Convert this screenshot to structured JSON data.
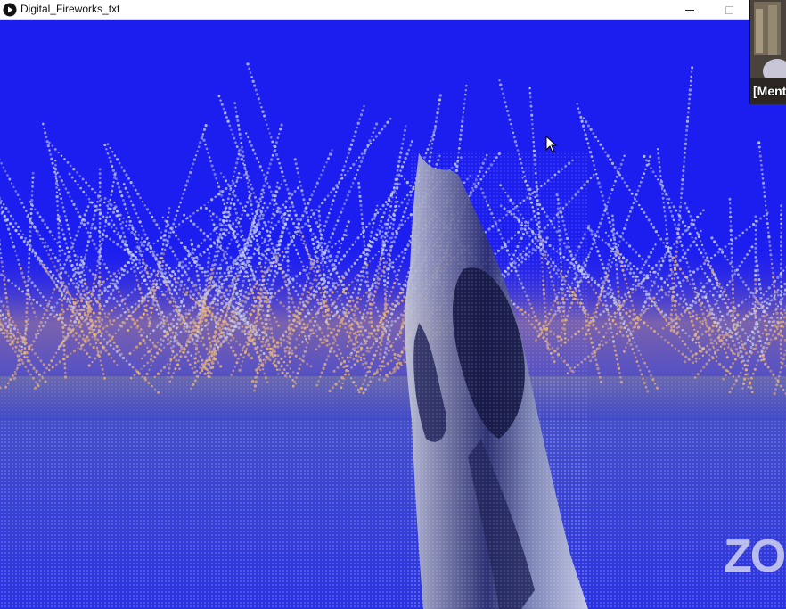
{
  "window": {
    "title": "Digital_Fireworks_txt",
    "icon": "play-circle-icon",
    "controls": [
      "minimize",
      "maximize"
    ]
  },
  "video_thumbnail": {
    "participant_label": "[Ment"
  },
  "watermark": {
    "text": "ZO"
  },
  "colors": {
    "background": "#1c1ef0",
    "spark_light": "#c8cfe8",
    "spark_warm": "#e9b57a"
  }
}
